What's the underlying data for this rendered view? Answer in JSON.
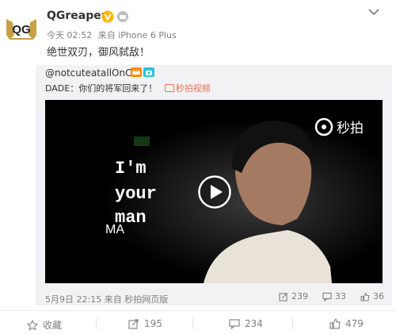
{
  "post": {
    "username": "QGreapers",
    "logo_text": "QG",
    "time": "今天 02:52",
    "source": "来自 iPhone 6 Plus",
    "content": "绝世双刃，御风弑敌！"
  },
  "repost": {
    "user": "@notcuteatallOnO",
    "text": "DADE：你们的将军回来了！",
    "link_text": "秒拍视频",
    "video": {
      "watermark": "秒拍",
      "line1": "I'm",
      "line2": "your",
      "line3": "man",
      "fragment": "MA"
    },
    "time": "5月9日 22:15",
    "source": "来自 秒拍网页版",
    "stats": {
      "reposts": "239",
      "comments": "33",
      "likes": "36"
    }
  },
  "actions": {
    "favorite": "收藏",
    "repost": "195",
    "comment": "234",
    "like": "479"
  },
  "colors": {
    "link": "#eb7350",
    "verified": "#ffb500",
    "meta": "#808080"
  }
}
